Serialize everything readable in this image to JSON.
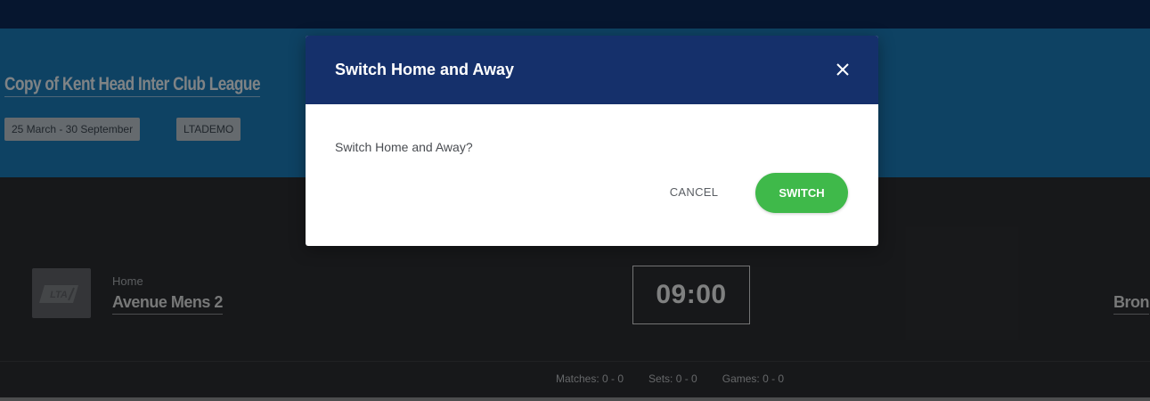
{
  "header": {
    "league_title": "Copy of Kent Head Inter Club League",
    "date_range_tag": "25 March - 30 September",
    "code_tag": "LTADEMO"
  },
  "match": {
    "home_label": "Home",
    "home_team": "Avenue Mens 2",
    "home_logo": "lta-logo",
    "time": "09:00",
    "away_team": "Bron",
    "stats": {
      "matches": "Matches: 0 - 0",
      "sets": "Sets: 0 - 0",
      "games": "Games: 0 - 0"
    }
  },
  "dialog": {
    "title": "Switch Home and Away",
    "message": "Switch Home and Away?",
    "cancel_label": "CANCEL",
    "confirm_label": "SWITCH",
    "close_icon": "close-icon"
  },
  "colors": {
    "topbar": "#0c2856",
    "header": "#1b78b5",
    "scoreboard": "#2b2d31",
    "dialog_header": "#15306b",
    "confirm_button": "#3fb94a"
  }
}
